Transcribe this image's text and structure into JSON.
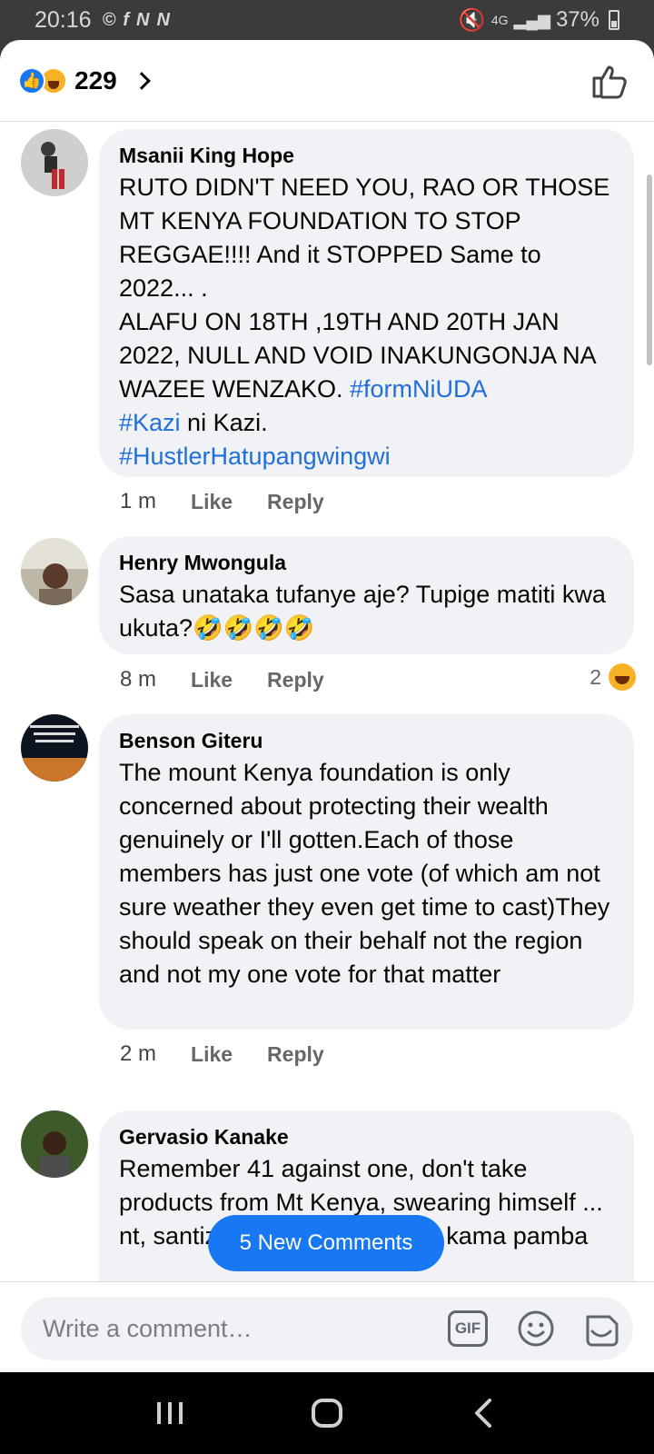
{
  "status_bar": {
    "time": "20:16",
    "notif_icons": [
      "©",
      "f",
      "N",
      "N"
    ],
    "signal_text": "4G",
    "battery": "37%"
  },
  "reactions": {
    "count": "229",
    "types": [
      "like-icon",
      "haha-icon"
    ]
  },
  "comments": [
    {
      "author": "Msanii King Hope",
      "body_parts": [
        {
          "text": "RUTO DIDN'T NEED YOU, RAO OR THOSE MT KENYA FOUNDATION TO STOP REGGAE!!!! And it STOPPED Same to 2022... .",
          "tag": false
        },
        {
          "text": "ALAFU ON 18TH ,19TH AND 20TH JAN 2022, NULL AND VOID INAKUNGONJA NA WAZEE WENZAKO.    ",
          "tag": false
        },
        {
          "text": "#formNiUDA",
          "tag": true
        },
        {
          "text": "#Kazi",
          "tag": true
        },
        {
          "text": " ni Kazi.",
          "tag": false
        },
        {
          "text": "#HustlerHatupangwingwi",
          "tag": true
        }
      ],
      "time": "1 m",
      "like": "Like",
      "reply": "Reply"
    },
    {
      "author": "Henry Mwongula",
      "body": "Sasa unataka tufanye aje? Tupige matiti kwa ukuta?🤣🤣🤣🤣",
      "time": "8 m",
      "like": "Like",
      "reply": "Reply",
      "reaction_count": "2"
    },
    {
      "author": "Benson Giteru",
      "body": "The mount Kenya foundation is only concerned about protecting their wealth genuinely or I'll gotten.Each of those members has just one vote (of which am not sure weather they even get time to cast)They should speak on their behalf not the region and not my one vote for that matter",
      "time": "2 m",
      "like": "Like",
      "reply": "Reply"
    },
    {
      "author": "Gervasio Kanake",
      "body": "Remember 41 against one, don't take products from Mt Kenya, swearing himself ... nt, santizer etc baba mweupe kama pamba",
      "time": "",
      "like": "",
      "reply": ""
    }
  ],
  "new_comments_label": "5 New Comments",
  "composer": {
    "placeholder": "Write a comment…",
    "gif_label": "GIF"
  },
  "colors": {
    "accent": "#1877f2",
    "hashtag": "#216fdb",
    "bubble": "#f0f2f5",
    "meta_text": "#65676b"
  }
}
